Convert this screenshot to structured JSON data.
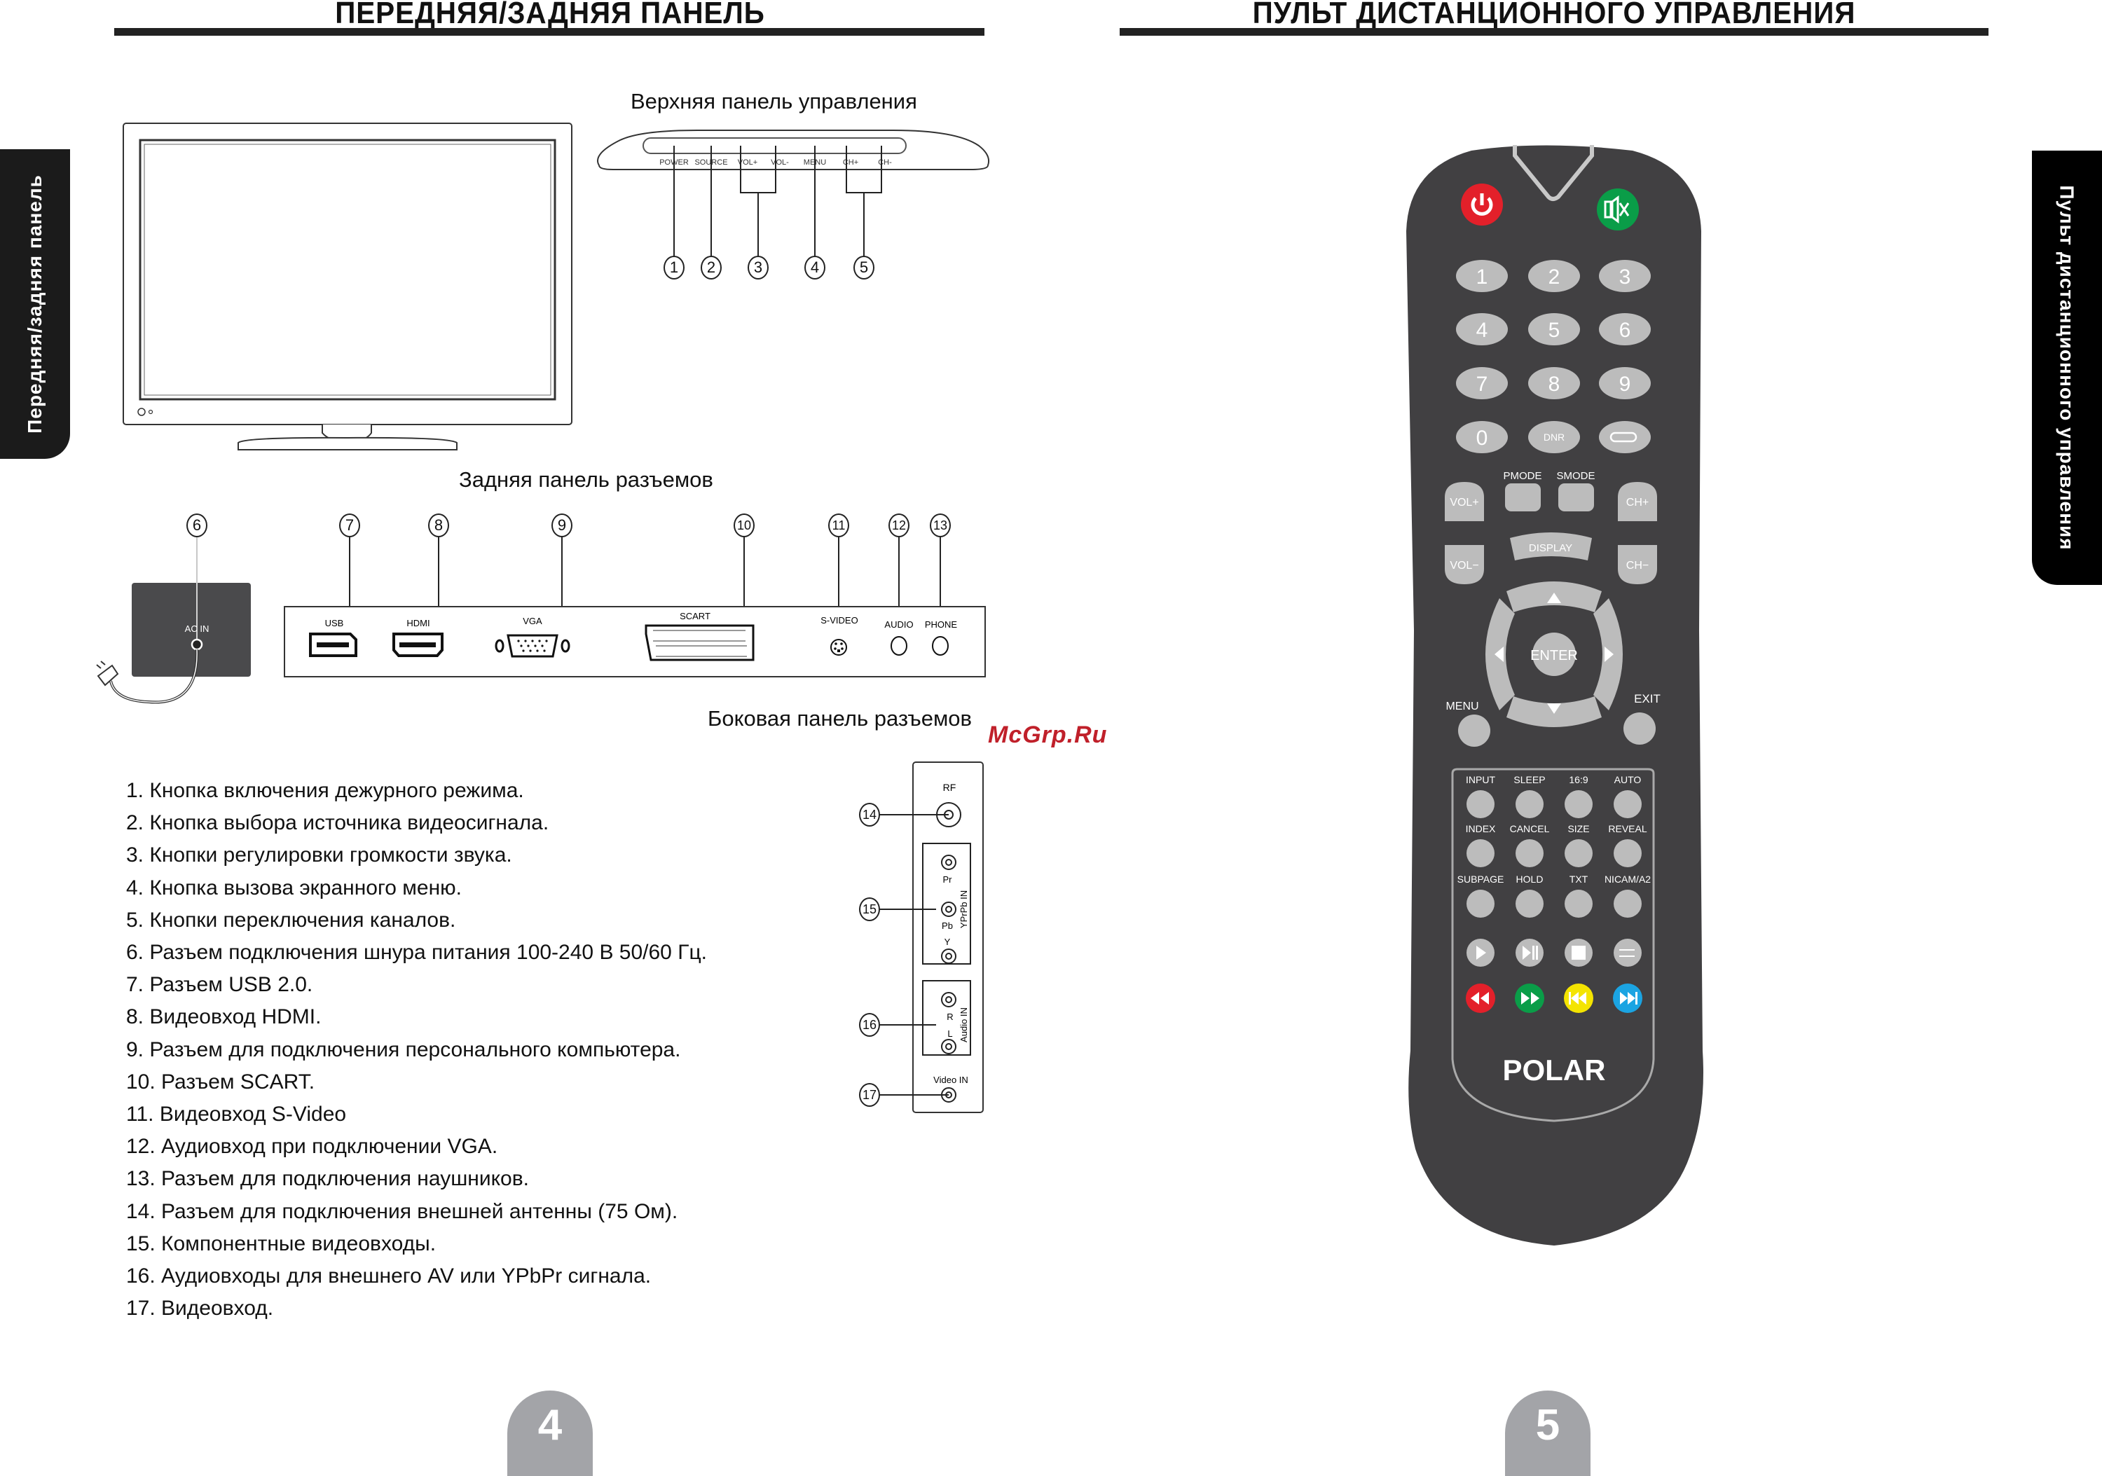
{
  "left_page": {
    "title": "ПЕРЕДНЯЯ/ЗАДНЯЯ ПАНЕЛЬ",
    "side_tab": "Передняя/задняя панель",
    "top_panel_caption": "Верхняя панель управления",
    "top_panel_buttons": [
      "POWER",
      "SOURCE",
      "VOL+",
      "VOL-",
      "MENU",
      "CH+",
      "CH-"
    ],
    "top_panel_callouts": [
      "1",
      "2",
      "3",
      "4",
      "5"
    ],
    "rear_panel_caption": "Задняя панель разъемов",
    "rear_callouts": [
      "6",
      "7",
      "8",
      "9",
      "10",
      "11",
      "12",
      "13"
    ],
    "rear_connectors": {
      "ac_in": "AC IN",
      "usb": "USB",
      "hdmi": "HDMI",
      "vga": "VGA",
      "scart": "SCART",
      "svideo": "S-VIDEO",
      "audio": "AUDIO",
      "phone": "PHONE"
    },
    "side_panel_caption": "Боковая панель разъемов",
    "side_callouts": [
      "14",
      "15",
      "16",
      "17"
    ],
    "side_connectors": {
      "rf": "RF",
      "pr": "Pr",
      "pb": "Pb",
      "y": "Y",
      "ypbpr_group": "YPrPb IN",
      "r": "R",
      "l": "L",
      "audio_group": "Audio IN",
      "video_in": "Video IN"
    },
    "descriptions": [
      "1. Кнопка включения дежурного режима.",
      "2. Кнопка выбора источника видеосигнала.",
      "3. Кнопки регулировки громкости звука.",
      "4. Кнопка вызова экранного меню.",
      "5. Кнопки переключения каналов.",
      "6. Разъем подключения шнура питания 100-240 В 50/60 Гц.",
      "7. Разъем USB 2.0.",
      "8. Видеовход HDMI.",
      "9. Разъем для подключения персонального компьютера.",
      "10. Разъем SCART.",
      "11. Видеовход S-Video",
      "12. Аудиовход при подключении VGA.",
      "13. Разъем для подключения наушников.",
      "14. Разъем для подключения внешней антенны (75 Ом).",
      "15. Компонентные видеовходы.",
      "16. Аудиовходы для внешнего AV или YPbPr сигнала.",
      "17. Видеовход."
    ],
    "page_number": "4"
  },
  "watermark": "McGrp.Ru",
  "right_page": {
    "title": "ПУЛЬТ ДИСТАНЦИОННОГО УПРАВЛЕНИЯ",
    "side_tab": "Пульт дистанционного управления",
    "page_number": "5",
    "remote": {
      "brand": "POLAR",
      "power_icon": "power-icon",
      "mute_icon": "mute-icon",
      "digits": [
        "1",
        "2",
        "3",
        "4",
        "5",
        "6",
        "7",
        "8",
        "9",
        "0",
        "DNR"
      ],
      "recall_icon": "recall-icon",
      "pmode": "PMODE",
      "smode": "SMODE",
      "vol_plus": "VOL+",
      "vol_minus": "VOL−",
      "ch_plus": "CH+",
      "ch_minus": "CH−",
      "display": "DISPLAY",
      "enter": "ENTER",
      "menu": "MENU",
      "exit": "EXIT",
      "function_keys": [
        "INPUT",
        "SLEEP",
        "16:9",
        "AUTO",
        "INDEX",
        "CANCEL",
        "SIZE",
        "REVEAL",
        "SUBPAGE",
        "HOLD",
        "TXT",
        "NICAM/A2"
      ],
      "media_keys": [
        "play-icon",
        "play-pause-icon",
        "stop-icon",
        "repeat-icon"
      ],
      "color_keys": [
        {
          "icon": "rewind-icon",
          "color": "#e3202a"
        },
        {
          "icon": "fast-forward-icon",
          "color": "#0a9d48"
        },
        {
          "icon": "previous-icon",
          "color": "#f4e400"
        },
        {
          "icon": "next-icon",
          "color": "#1ba4e2"
        }
      ],
      "body_color": "#414042",
      "key_color": "#bcbcbc",
      "power_color": "#e3202a",
      "mute_color": "#0a9d48"
    }
  }
}
